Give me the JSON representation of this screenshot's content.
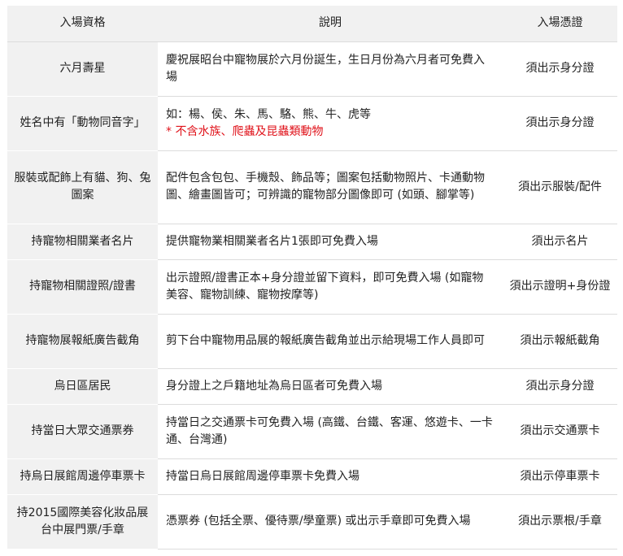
{
  "headers": {
    "qualification": "入場資格",
    "description": "說明",
    "credential": "入場憑證"
  },
  "rows": [
    {
      "qualification": "六月壽星",
      "description": "慶祝展昭台中寵物展於六月份誕生，生日月份為六月者可免費入場",
      "note": "",
      "credential": "須出示身分證"
    },
    {
      "qualification": "姓名中有「動物同音字」",
      "description": "如：楊、侯、朱、馬、駱、熊、牛、虎等",
      "note": "* 不含水族、爬蟲及昆蟲類動物",
      "credential": "須出示身分證"
    },
    {
      "qualification": "服裝或配飾上有貓、狗、兔圖案",
      "description": "配件包含包包、手機殼、飾品等；圖案包括動物照片、卡通動物圖、繪畫圖皆可；可辨識的寵物部分圖像即可 (如頭、腳掌等)",
      "note": "",
      "credential": "須出示服裝/配件"
    },
    {
      "qualification": "持寵物相關業者名片",
      "description": "提供寵物業相關業者名片1張即可免費入場",
      "note": "",
      "credential": "須出示名片"
    },
    {
      "qualification": "持寵物相關證照/證書",
      "description": "出示證照/證書正本+身分證並留下資料，即可免費入場 (如寵物美容、寵物訓練、寵物按摩等)",
      "note": "",
      "credential": "須出示證明+身份證"
    },
    {
      "qualification": "持寵物展報紙廣告截角",
      "description": "剪下台中寵物用品展的報紙廣告截角並出示給現場工作人員即可",
      "note": "",
      "credential": "須出示報紙截角"
    },
    {
      "qualification": "烏日區居民",
      "description": "身分證上之戶籍地址為烏日區者可免費入場",
      "note": "",
      "credential": "須出示身分證"
    },
    {
      "qualification": "持當日大眾交通票券",
      "description": "持當日之交通票卡可免費入場 (高鐵、台鐵、客運、悠遊卡、一卡通、台灣通)",
      "note": "",
      "credential": "須出示交通票卡"
    },
    {
      "qualification": "持烏日展館周邊停車票卡",
      "description": "持當日烏日展館周邊停車票卡免費入場",
      "note": "",
      "credential": "須出示停車票卡"
    },
    {
      "qualification": "持2015國際美容化妝品展台中展門票/手章",
      "description": "憑票券 (包括全票、優待票/學童票) 或出示手章即可免費入場",
      "note": "",
      "credential": "須出示票根/手章"
    }
  ]
}
